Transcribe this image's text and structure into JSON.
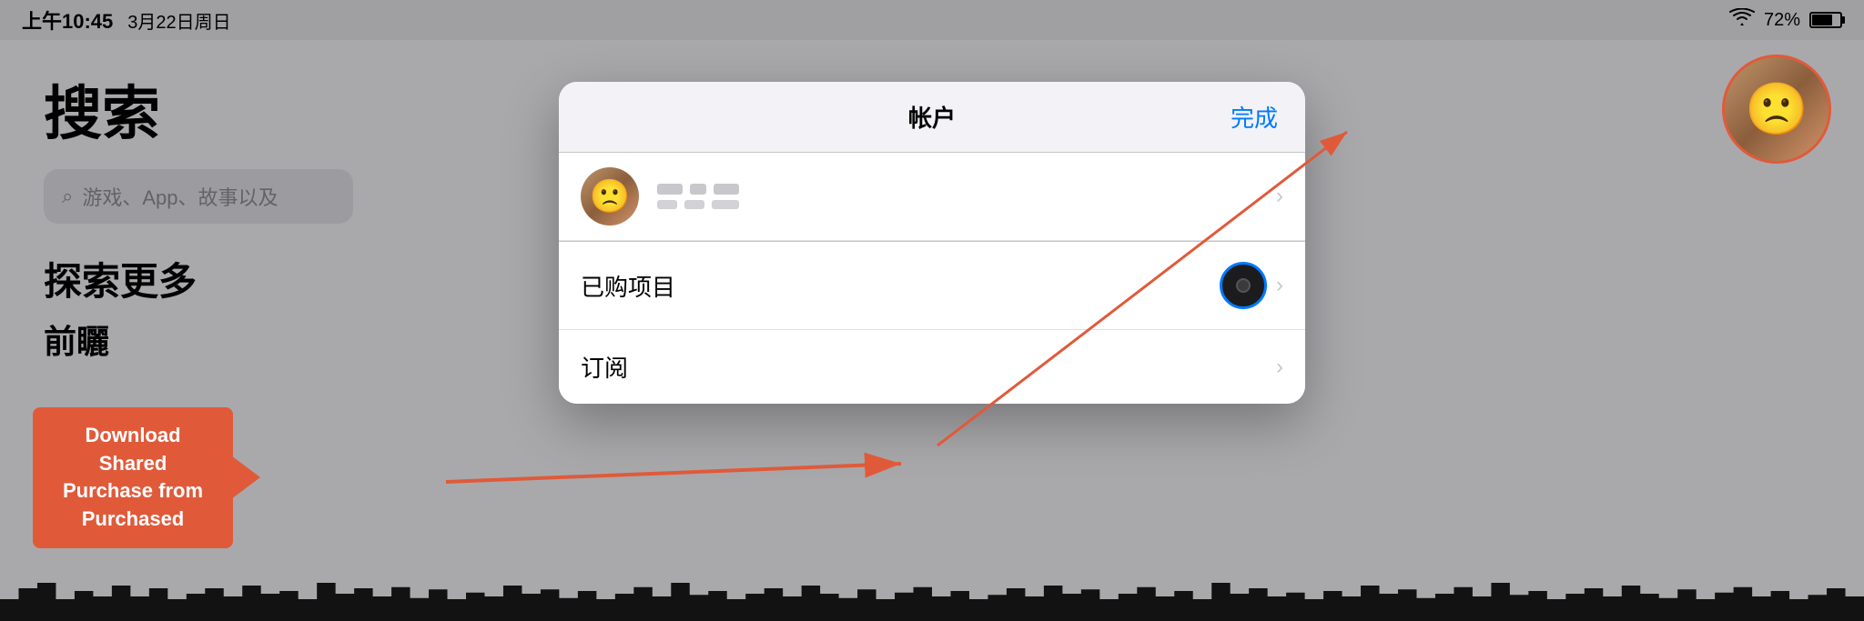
{
  "statusBar": {
    "time": "上午10:45",
    "date": "3月22日周日",
    "wifiIcon": "wifi",
    "batteryPercent": "72%"
  },
  "background": {
    "searchTitle": "搜索",
    "searchPlaceholder": "游戏、App、故事以及",
    "exploreTitle": "探索更多",
    "bottomText": "前矖"
  },
  "modal": {
    "title": "帐户",
    "doneLabel": "完成",
    "accountRow": {
      "nameBlocks": [
        "■■",
        "■■",
        "■■"
      ],
      "subBlocks": [
        "■■■",
        "■■■"
      ]
    },
    "purchasedRow": {
      "label": "已购项目"
    },
    "subscriptionsRow": {
      "label": "订阅"
    }
  },
  "annotation": {
    "arrowLabel": "Download Shared Purchase from Purchased"
  },
  "icons": {
    "searchIcon": "🔍",
    "chevronRight": "›",
    "wifi": "📶"
  }
}
